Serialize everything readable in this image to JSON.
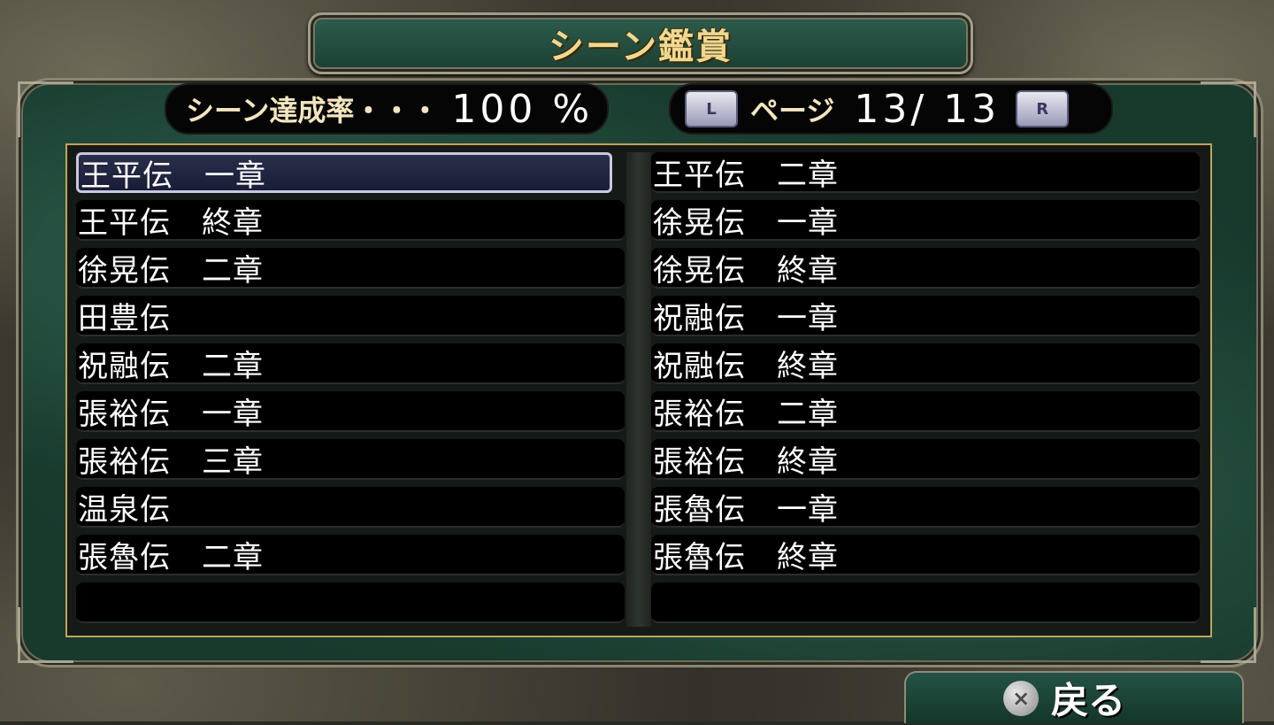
{
  "title": "シーン鑑賞",
  "status": {
    "rate_label": "シーン達成率・・・",
    "rate_value": "100 %",
    "page_label": "ページ",
    "page_value": "13/ 13",
    "key_left": "L",
    "key_right": "R"
  },
  "list": {
    "left": [
      "王平伝　一章",
      "王平伝　終章",
      "徐晃伝　二章",
      "田豊伝",
      "祝融伝　二章",
      "張裕伝　一章",
      "張裕伝　三章",
      "温泉伝",
      "張魯伝　二章",
      ""
    ],
    "right": [
      "王平伝　二章",
      "徐晃伝　一章",
      "徐晃伝　終章",
      "祝融伝　一章",
      "祝融伝　終章",
      "張裕伝　二章",
      "張裕伝　終章",
      "張魯伝　一章",
      "張魯伝　終章",
      ""
    ],
    "selected": "left-0"
  },
  "back": {
    "icon": "cross-button-icon",
    "label": "戻る"
  }
}
